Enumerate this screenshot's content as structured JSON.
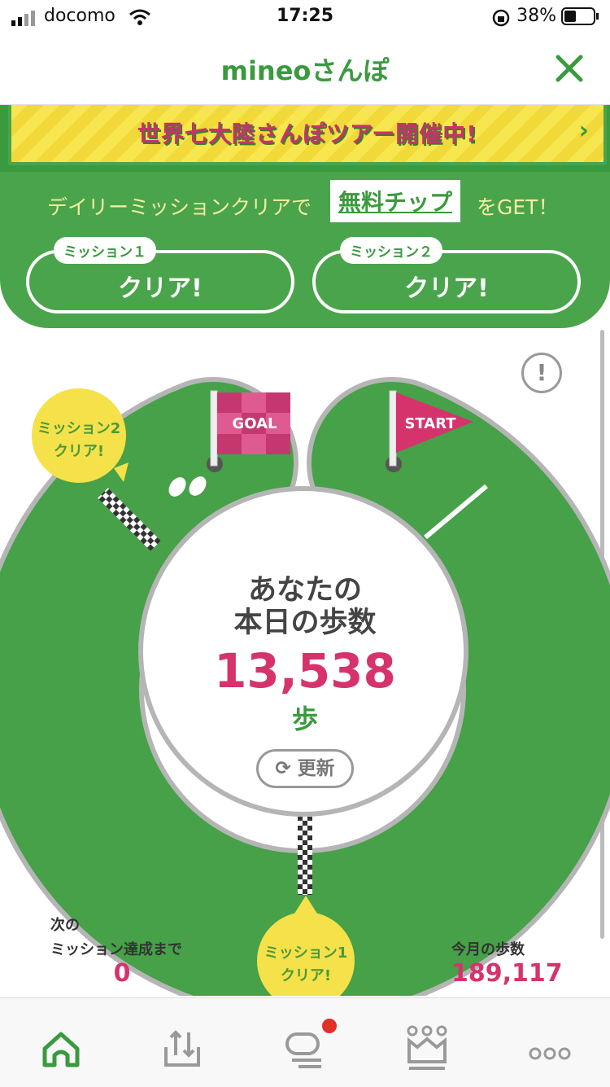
{
  "status_bar": {
    "carrier": "docomo",
    "time": "17:25",
    "battery": "38%"
  },
  "header": {
    "title": "mineoさんぽ",
    "close_icon": "close-icon"
  },
  "banner": {
    "text": "世界七大陸さんぽツアー開催中!",
    "chevron": "›"
  },
  "missions": {
    "lead": "デイリーミッションクリアで",
    "chip": "無料チップ",
    "tail": "をGET！",
    "items": [
      {
        "tag": "ミッション１",
        "value": "クリア!"
      },
      {
        "tag": "ミッション２",
        "value": "クリア!"
      }
    ]
  },
  "track": {
    "goal_flag": "GOAL",
    "start_flag": "START",
    "mission2_bubble": [
      "ミッション2",
      "クリア!"
    ],
    "mission1_bubble": [
      "ミッション1",
      "クリア!"
    ],
    "info": "!"
  },
  "steps": {
    "line1": "あなたの",
    "line2": "本日の歩数",
    "value": "13,538",
    "unit": "歩",
    "refresh": "更新"
  },
  "stats": {
    "next_label_1": "次の",
    "next_label_2": "ミッション達成まで",
    "next_value": "0",
    "month_label": "今月の歩数",
    "month_value": "189,117"
  },
  "tabs": [
    {
      "icon": "home-icon",
      "active": true
    },
    {
      "icon": "upload-icon",
      "active": false
    },
    {
      "icon": "chat-icon",
      "active": false,
      "badge": true
    },
    {
      "icon": "crown-icon",
      "active": false
    },
    {
      "icon": "more-icon",
      "active": false
    }
  ],
  "colors": {
    "brand_green": "#3a9a3e",
    "track_green": "#46a148",
    "accent_pink": "#d6336c",
    "bubble_yellow": "#f5e14a"
  }
}
